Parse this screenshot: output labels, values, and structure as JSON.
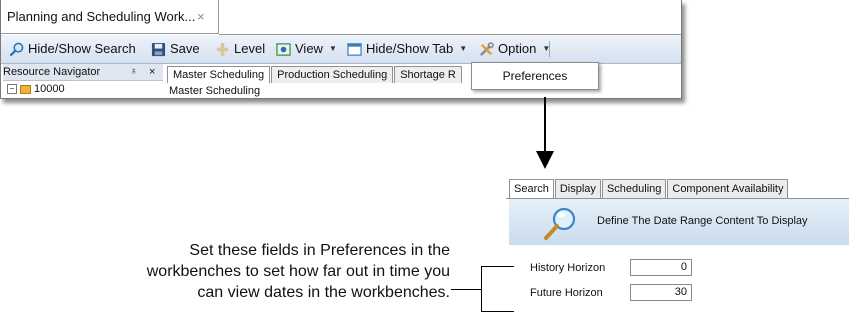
{
  "window": {
    "doc_tab_title": "Planning and Scheduling Work...",
    "doc_tab_close": "×",
    "toolbar": {
      "hide_show_search": "Hide/Show Search",
      "save": "Save",
      "level": "Level",
      "view": "View",
      "hide_show_tab": "Hide/Show Tab",
      "option": "Option"
    },
    "resource_navigator": {
      "title": "Resource Navigator",
      "pin": "♁",
      "close": "×",
      "tree_item": "10000"
    },
    "inner_tabs": [
      "Master Scheduling",
      "Production Scheduling",
      "Shortage R"
    ],
    "content_label": "Master Scheduling",
    "option_menu": {
      "item": "Preferences"
    }
  },
  "preferences": {
    "tabs": [
      "Search",
      "Display",
      "Scheduling",
      "Component Availability"
    ],
    "header_text": "Define The Date Range Content To Display",
    "history_horizon_label": "History Horizon",
    "history_horizon_value": "0",
    "future_horizon_label": "Future Horizon",
    "future_horizon_value": "30"
  },
  "annotation": {
    "line1": "Set these fields in Preferences in the",
    "line2": "workbenches to set how far out in time you",
    "line3": "can view dates in the workbenches."
  },
  "colors": {
    "toolbar_top": "#eef3fa",
    "toolbar_bottom": "#d5e0ef",
    "header_gradient_top": "#e6f0f8",
    "header_gradient_bottom": "#c9dcec"
  }
}
